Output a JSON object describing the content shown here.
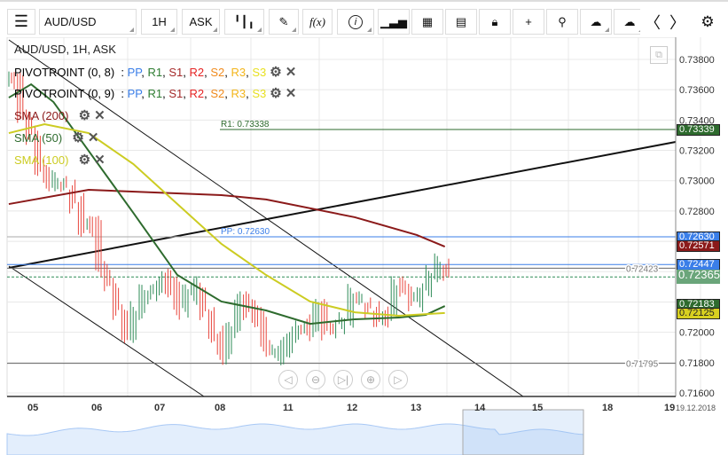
{
  "toolbar": {
    "menu_icon": "hamburger-icon",
    "symbol": "AUD/USD",
    "interval": "1H",
    "price_type": "ASK",
    "items": [
      "candles-icon",
      "pencil-icon",
      "function-icon",
      "info-icon",
      "bar-chart-icon",
      "calendar-icon",
      "report-icon",
      "lock-icon",
      "crosshair-icon",
      "zoom-search-icon",
      "cloud-upload-icon",
      "cloud-download-icon",
      "chevron-left-icon",
      "chevron-right-icon",
      "gear-icon"
    ],
    "fx_label": "f(x)",
    "info_label": "i"
  },
  "legend": {
    "title": "AUD/USD, 1H, ASK",
    "pivots": [
      {
        "name": "PIVOTROINT (0, 8)"
      },
      {
        "name": "PIVOTROINT (0, 9)"
      }
    ],
    "pivot_parts": [
      {
        "t": "PP",
        "c": "#3a7ee8"
      },
      {
        "t": "R1",
        "c": "#2e7d32"
      },
      {
        "t": "S1",
        "c": "#a52a2a"
      },
      {
        "t": "R2",
        "c": "#e52222"
      },
      {
        "t": "S2",
        "c": "#f08a1c"
      },
      {
        "t": "R3",
        "c": "#f3b51a"
      },
      {
        "t": "S3",
        "c": "#e8e020"
      }
    ],
    "smas": [
      {
        "name": "SMA (200)",
        "color": "#8b1a1a"
      },
      {
        "name": "SMA (50)",
        "color": "#2e6b2e"
      },
      {
        "name": "SMA (100)",
        "color": "#cccc22"
      }
    ]
  },
  "chart_data": {
    "type": "candlestick",
    "symbol": "AUD/USD",
    "ylim": [
      0.7158,
      0.7392
    ],
    "y_ticks": [
      "0.73800",
      "0.73600",
      "0.73400",
      "0.73200",
      "0.73000",
      "0.72800",
      "0.72600",
      "0.72400",
      "0.72200",
      "0.72000",
      "0.71800",
      "0.71600"
    ],
    "y_tick_values": [
      0.738,
      0.736,
      0.734,
      0.732,
      0.73,
      0.728,
      0.726,
      0.724,
      0.722,
      0.72,
      0.718,
      0.716
    ],
    "x_ticks": [
      "05",
      "06",
      "07",
      "08",
      "11",
      "12",
      "13",
      "14",
      "15",
      "18",
      "19"
    ],
    "x_end_label": "19.12.2018",
    "closes": [
      0.7365,
      0.734,
      0.733,
      0.731,
      0.73,
      0.73,
      0.7295,
      0.7285,
      0.727,
      0.727,
      0.724,
      0.723,
      0.7215,
      0.72,
      0.7215,
      0.7225,
      0.7225,
      0.7235,
      0.723,
      0.7215,
      0.7225,
      0.723,
      0.7215,
      0.72,
      0.7185,
      0.72,
      0.722,
      0.7215,
      0.721,
      0.719,
      0.7185,
      0.719,
      0.72,
      0.7205,
      0.72,
      0.7215,
      0.72,
      0.7205,
      0.721,
      0.7225,
      0.722,
      0.7215,
      0.721,
      0.721,
      0.723,
      0.7225,
      0.722,
      0.723,
      0.724,
      0.7245,
      0.7236
    ],
    "sma200": [
      [
        -0.39,
        0.72846
      ],
      [
        0.86,
        0.7294
      ],
      [
        2.94,
        0.72905
      ],
      [
        3.64,
        0.72876
      ],
      [
        5.03,
        0.72759
      ],
      [
        6,
        0.72642
      ],
      [
        6.44,
        0.72565
      ]
    ],
    "sma50": [
      [
        -0.39,
        0.73548
      ],
      [
        -0.04,
        0.73636
      ],
      [
        0.31,
        0.73519
      ],
      [
        0.86,
        0.73197
      ],
      [
        1.56,
        0.72788
      ],
      [
        2.25,
        0.72378
      ],
      [
        2.94,
        0.72203
      ],
      [
        3.64,
        0.72144
      ],
      [
        4.33,
        0.72056
      ],
      [
        5.03,
        0.72086
      ],
      [
        5.72,
        0.72097
      ],
      [
        6.14,
        0.72115
      ],
      [
        6.44,
        0.72173
      ]
    ],
    "sma100": [
      [
        -0.39,
        0.73314
      ],
      [
        0.17,
        0.73373
      ],
      [
        0.86,
        0.73314
      ],
      [
        1.56,
        0.7311
      ],
      [
        2.25,
        0.72846
      ],
      [
        2.94,
        0.72583
      ],
      [
        3.64,
        0.72378
      ],
      [
        4.33,
        0.72203
      ],
      [
        5.03,
        0.72132
      ],
      [
        5.72,
        0.72109
      ],
      [
        6.44,
        0.72127
      ]
    ],
    "levels": {
      "r1_label": "R1: 0.73338",
      "r1": 0.73338,
      "pp_label": "PP: 0.72630",
      "pp": 0.7263,
      "arrow1_label": "0.72423",
      "arrow1": 0.72423,
      "arrow2_label": "0.71795",
      "arrow2": 0.71795,
      "last": 0.72365,
      "ask_line": 0.72447
    },
    "price_labels": [
      {
        "t": "0.73339",
        "v": 0.73339,
        "c": "#2e6b2e"
      },
      {
        "t": "0.72630",
        "v": 0.7263,
        "c": "#3a7ee8"
      },
      {
        "t": "0.72571",
        "v": 0.72571,
        "c": "#8b1a1a"
      },
      {
        "t": "0.72447",
        "v": 0.72447,
        "c": "#3a7ee8"
      },
      {
        "t": "0.72365",
        "v": 0.72365,
        "c": "#6aa57a"
      },
      {
        "t": "0.72183",
        "v": 0.72183,
        "c": "#2e6b2e"
      },
      {
        "t": "0.72125",
        "v": 0.72125,
        "c": "#d8d020"
      }
    ]
  },
  "nav_buttons": [
    "scroll-left-icon",
    "zoom-out-icon",
    "go-to-end-icon",
    "zoom-in-icon",
    "scroll-right-icon"
  ],
  "nav_glyphs": [
    "◁",
    "⊖",
    "▷|",
    "⊕",
    "▷"
  ],
  "colors": {
    "up": "#2e8b57",
    "down": "#e8453c"
  }
}
